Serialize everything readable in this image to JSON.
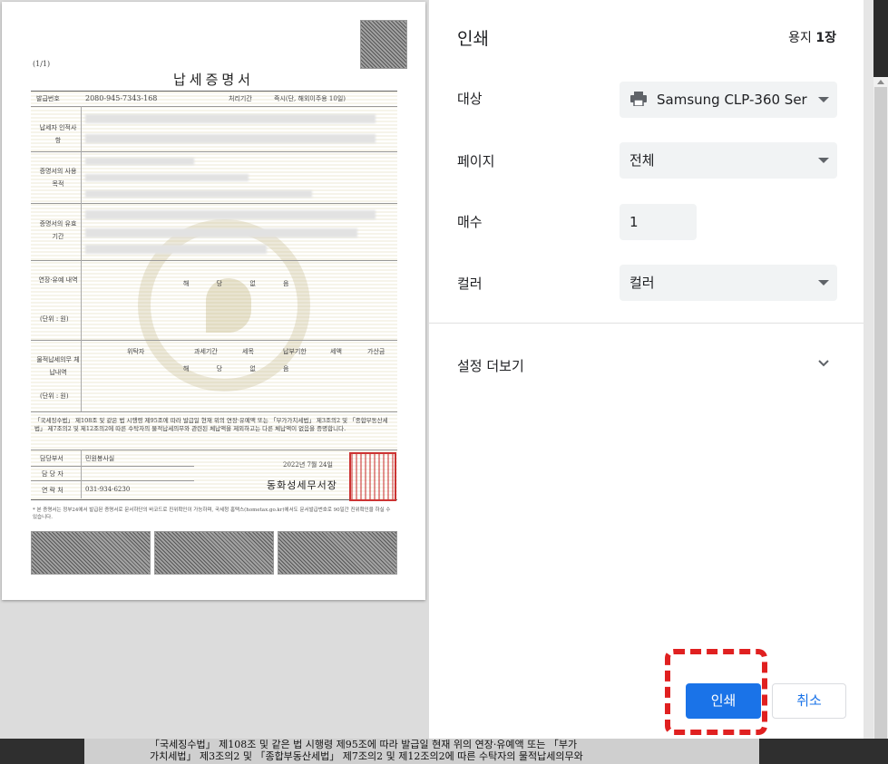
{
  "document": {
    "page_indicator": "(1/1)",
    "title": "납세증명서",
    "issue_no_label": "발급번호",
    "issue_no": "2080-945-7343-168",
    "process_label": "처리기간",
    "process_value": "즉시(단, 해외이주용 10일)",
    "taxpayer_label": "납세자 인적사항",
    "purpose_label": "증명서의 사용목적",
    "validity_label": "증명서의 유효기간",
    "deferral_label": "연장·유예 내역",
    "unit_label": "(단위 : 원)",
    "none_text": "해 당 없 음",
    "trustee_label": "물적납세의무 체납내역",
    "trustee_cols": [
      "위탁자",
      "과세기간",
      "세목",
      "납부기한",
      "세액",
      "가산금"
    ],
    "unit_label_2": "(단위 : 원)",
    "none_text_2": "해 당 없 음",
    "statement": "「국세징수법」 제108조 및 같은 법 시행령 제95조에 따라 발급일 현재 위의 연장·유예액 또는 「부가가치세법」 제3조의2 및 「종합부동산세법」 제7조의2 및 제12조의2에 따른 수탁자의 물적납세의무와 관련된 체납액을 제외하고는 다른 체납액이 없음을 증명합니다.",
    "dept_label": "담당부서",
    "dept_value": "민원봉사실",
    "person_label": "담 당 자",
    "contact_label": "연 락 처",
    "contact_value": "031-934-6230",
    "date": "2022년 7월 24일",
    "issuer": "동화성세무서장",
    "footnote": "* 본 증명서는 정부24에서 발급된 증명서로 문서하단의 바코드로 진위확인이 가능하며, 국세청 홈택스(hometax.go.kr)에서도 문서발급번호로 90일간 진위확인을 하실 수 있습니다."
  },
  "print_panel": {
    "title": "인쇄",
    "sheet_count_prefix": "용지 ",
    "sheet_count_value": "1장",
    "destination_label": "대상",
    "destination_value": "Samsung CLP-360 Ser",
    "destination_icon": "printer-icon",
    "pages_label": "페이지",
    "pages_value": "전체",
    "copies_label": "매수",
    "copies_value": "1",
    "color_label": "컬러",
    "color_value": "컬러",
    "more_settings": "설정 더보기",
    "print_button": "인쇄",
    "cancel_button": "취소",
    "accent_color": "#1a73e8",
    "highlight_color": "#e02020"
  },
  "background_text": {
    "line1": "「국세징수법」 제108조 및 같은 법 시행령 제95조에 따라 발급일 현재 위의 연장·유예액 또는 「부가",
    "line2": "가치세법」 제3조의2 및 「종합부동산세법」 제7조의2 및 제12조의2에 따른 수탁자의 물적납세의무와"
  }
}
